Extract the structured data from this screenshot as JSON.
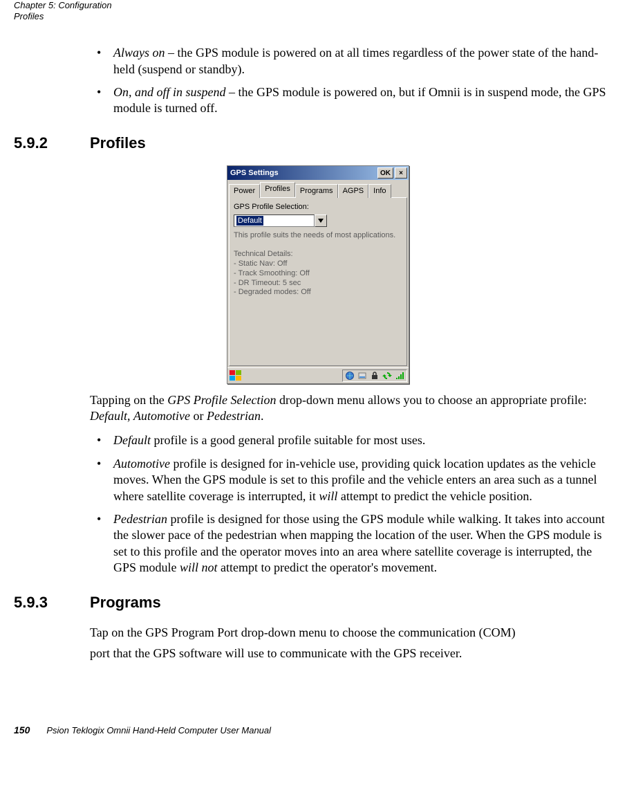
{
  "running_head": "Chapter 5:  Configuration\nProfiles",
  "intro_bullets": [
    {
      "term": " Always on",
      "rest": " – the GPS module is powered on at all times regardless of the power state of the hand-held (suspend or standby)."
    },
    {
      "term": "On, and off in suspend",
      "rest": " – the GPS module is powered on, but if Omnii is in suspend mode, the GPS module is turned off."
    }
  ],
  "h592": {
    "num": "5.9.2",
    "title": "Profiles"
  },
  "win": {
    "title": "GPS Settings",
    "ok": "OK",
    "close": "×",
    "tabs": [
      "Power",
      "Profiles",
      "Programs",
      "AGPS",
      "Info"
    ],
    "active_tab_index": 1,
    "label": "GPS Profile Selection:",
    "selected": "Default",
    "desc": "This profile suits the needs of most applications.\n\nTechnical Details:\n- Static Nav: Off\n- Track Smoothing: Off\n- DR Timeout: 5 sec\n- Degraded modes: Off"
  },
  "after_screenshot_inline": {
    "pre": "Tapping on the ",
    "i1": "GPS Profile Selection",
    "mid": " drop-down menu allows you to choose an appropriate profile: ",
    "i2": "Default",
    "c1": ", ",
    "i3": "Automotive",
    "c2": " or ",
    "i4": "Pedestrian",
    "end": "."
  },
  "profile_bullets": [
    {
      "term": "Default",
      "rest": " profile is a good general profile suitable for most uses."
    },
    {
      "term": "Automotive",
      "rest_a": " profile is designed for in-vehicle use, providing quick location updates as the vehicle moves. When the GPS module is set to this profile and the vehicle enters an area such as a tunnel where satellite coverage is interrupted, it ",
      "will": "will",
      "rest_b": " attempt to predict the vehicle position."
    },
    {
      "term": "Pedestrian",
      "rest_a": " profile is designed for those using the GPS module while walking. It takes into account the slower pace of the pedestrian when mapping the location of the user. When the GPS module is set to this profile and the operator moves into an area where satellite coverage is interrupted, the GPS module ",
      "willnot": "will not",
      "rest_b": " attempt to predict the operator's movement."
    }
  ],
  "h593": {
    "num": "5.9.3",
    "title": "Programs"
  },
  "programs_p1": "Tap on the GPS Program Port drop-down menu to choose the communication (COM)",
  "programs_p2": "port that the GPS software will use to communicate with the GPS receiver.",
  "footer": {
    "page": "150",
    "text": "Psion Teklogix Omnii Hand-Held Computer User Manual"
  }
}
